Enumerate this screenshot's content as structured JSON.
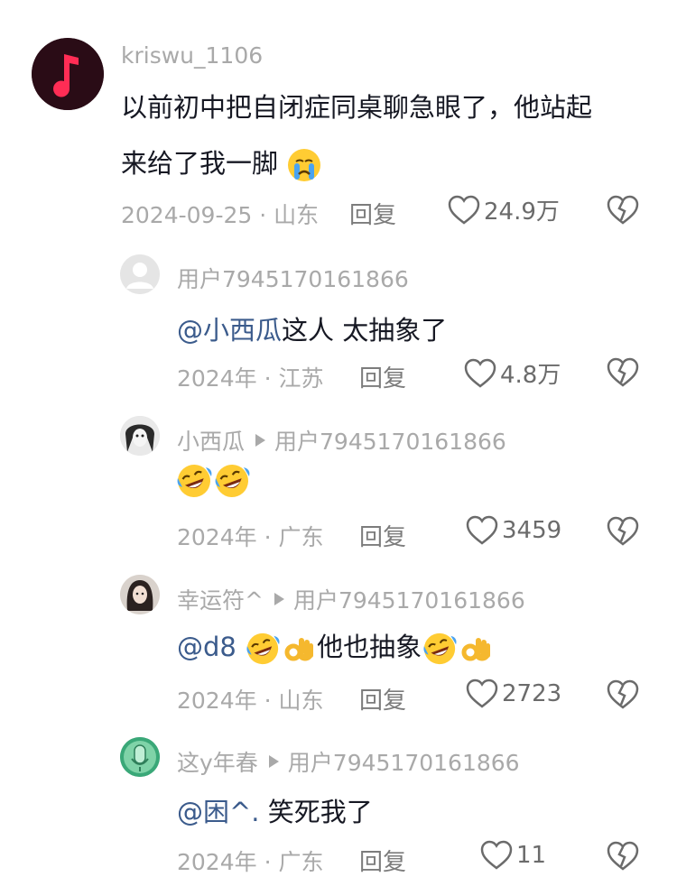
{
  "comments": [
    {
      "username": "kriswu_1106",
      "text": "以前初中把自闭症同桌聊急眼了，他站起",
      "text_line2": "来给了我一脚",
      "emojis": [
        "crying-emoji"
      ],
      "meta": "2024-09-25 · 山东",
      "reply_label": "回复",
      "likes": "24.9万"
    },
    {
      "username": "用户7945170161866",
      "mention": "@小西瓜",
      "text": "这人 太抽象了",
      "meta": "2024年 · 江苏",
      "reply_label": "回复",
      "likes": "4.8万"
    },
    {
      "username": "小西瓜",
      "reply_to": "用户7945170161866",
      "emojis": [
        "rofl-emoji",
        "rofl-emoji"
      ],
      "meta": "2024年 · 广东",
      "reply_label": "回复",
      "likes": "3459"
    },
    {
      "username": "幸运符^",
      "reply_to": "用户7945170161866",
      "mention": "@d8",
      "text": "他也抽象",
      "emojis": [
        "rofl-emoji",
        "ok-hand-emoji",
        "rofl-emoji",
        "ok-hand-emoji"
      ],
      "meta": "2024年 · 山东",
      "reply_label": "回复",
      "likes": "2723"
    },
    {
      "username": "这y年春",
      "reply_to": "用户7945170161866",
      "mention": "@困^.",
      "text": " 笑死我了",
      "meta": "2024年 · 广东",
      "reply_label": "回复",
      "likes": "11"
    }
  ],
  "colors": {
    "username": "#a9a9a9",
    "text": "#161823",
    "mention": "#3b5b8c",
    "meta": "#a9a9a9",
    "icon": "#6b6b6b"
  }
}
